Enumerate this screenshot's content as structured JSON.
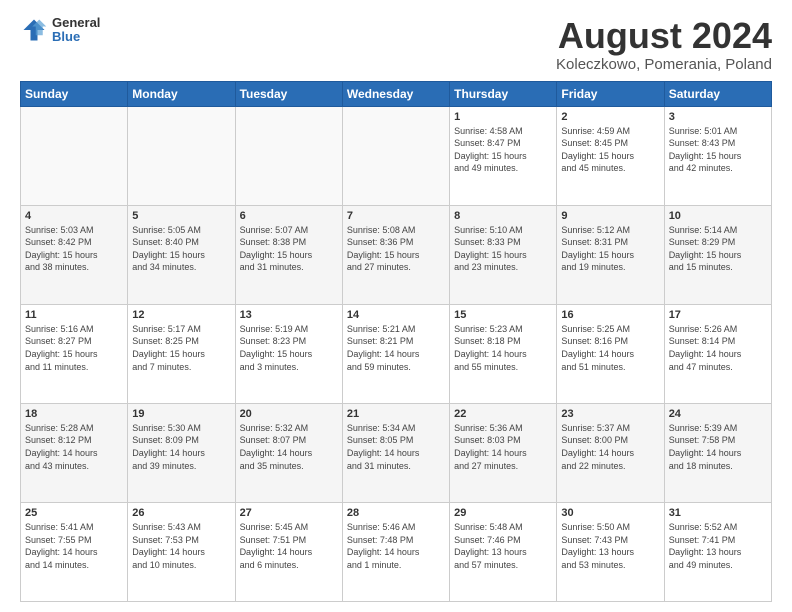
{
  "header": {
    "logo_line1": "General",
    "logo_line2": "Blue",
    "main_title": "August 2024",
    "subtitle": "Koleczkowo, Pomerania, Poland"
  },
  "weekdays": [
    "Sunday",
    "Monday",
    "Tuesday",
    "Wednesday",
    "Thursday",
    "Friday",
    "Saturday"
  ],
  "weeks": [
    [
      {
        "day": "",
        "info": ""
      },
      {
        "day": "",
        "info": ""
      },
      {
        "day": "",
        "info": ""
      },
      {
        "day": "",
        "info": ""
      },
      {
        "day": "1",
        "info": "Sunrise: 4:58 AM\nSunset: 8:47 PM\nDaylight: 15 hours\nand 49 minutes."
      },
      {
        "day": "2",
        "info": "Sunrise: 4:59 AM\nSunset: 8:45 PM\nDaylight: 15 hours\nand 45 minutes."
      },
      {
        "day": "3",
        "info": "Sunrise: 5:01 AM\nSunset: 8:43 PM\nDaylight: 15 hours\nand 42 minutes."
      }
    ],
    [
      {
        "day": "4",
        "info": "Sunrise: 5:03 AM\nSunset: 8:42 PM\nDaylight: 15 hours\nand 38 minutes."
      },
      {
        "day": "5",
        "info": "Sunrise: 5:05 AM\nSunset: 8:40 PM\nDaylight: 15 hours\nand 34 minutes."
      },
      {
        "day": "6",
        "info": "Sunrise: 5:07 AM\nSunset: 8:38 PM\nDaylight: 15 hours\nand 31 minutes."
      },
      {
        "day": "7",
        "info": "Sunrise: 5:08 AM\nSunset: 8:36 PM\nDaylight: 15 hours\nand 27 minutes."
      },
      {
        "day": "8",
        "info": "Sunrise: 5:10 AM\nSunset: 8:33 PM\nDaylight: 15 hours\nand 23 minutes."
      },
      {
        "day": "9",
        "info": "Sunrise: 5:12 AM\nSunset: 8:31 PM\nDaylight: 15 hours\nand 19 minutes."
      },
      {
        "day": "10",
        "info": "Sunrise: 5:14 AM\nSunset: 8:29 PM\nDaylight: 15 hours\nand 15 minutes."
      }
    ],
    [
      {
        "day": "11",
        "info": "Sunrise: 5:16 AM\nSunset: 8:27 PM\nDaylight: 15 hours\nand 11 minutes."
      },
      {
        "day": "12",
        "info": "Sunrise: 5:17 AM\nSunset: 8:25 PM\nDaylight: 15 hours\nand 7 minutes."
      },
      {
        "day": "13",
        "info": "Sunrise: 5:19 AM\nSunset: 8:23 PM\nDaylight: 15 hours\nand 3 minutes."
      },
      {
        "day": "14",
        "info": "Sunrise: 5:21 AM\nSunset: 8:21 PM\nDaylight: 14 hours\nand 59 minutes."
      },
      {
        "day": "15",
        "info": "Sunrise: 5:23 AM\nSunset: 8:18 PM\nDaylight: 14 hours\nand 55 minutes."
      },
      {
        "day": "16",
        "info": "Sunrise: 5:25 AM\nSunset: 8:16 PM\nDaylight: 14 hours\nand 51 minutes."
      },
      {
        "day": "17",
        "info": "Sunrise: 5:26 AM\nSunset: 8:14 PM\nDaylight: 14 hours\nand 47 minutes."
      }
    ],
    [
      {
        "day": "18",
        "info": "Sunrise: 5:28 AM\nSunset: 8:12 PM\nDaylight: 14 hours\nand 43 minutes."
      },
      {
        "day": "19",
        "info": "Sunrise: 5:30 AM\nSunset: 8:09 PM\nDaylight: 14 hours\nand 39 minutes."
      },
      {
        "day": "20",
        "info": "Sunrise: 5:32 AM\nSunset: 8:07 PM\nDaylight: 14 hours\nand 35 minutes."
      },
      {
        "day": "21",
        "info": "Sunrise: 5:34 AM\nSunset: 8:05 PM\nDaylight: 14 hours\nand 31 minutes."
      },
      {
        "day": "22",
        "info": "Sunrise: 5:36 AM\nSunset: 8:03 PM\nDaylight: 14 hours\nand 27 minutes."
      },
      {
        "day": "23",
        "info": "Sunrise: 5:37 AM\nSunset: 8:00 PM\nDaylight: 14 hours\nand 22 minutes."
      },
      {
        "day": "24",
        "info": "Sunrise: 5:39 AM\nSunset: 7:58 PM\nDaylight: 14 hours\nand 18 minutes."
      }
    ],
    [
      {
        "day": "25",
        "info": "Sunrise: 5:41 AM\nSunset: 7:55 PM\nDaylight: 14 hours\nand 14 minutes."
      },
      {
        "day": "26",
        "info": "Sunrise: 5:43 AM\nSunset: 7:53 PM\nDaylight: 14 hours\nand 10 minutes."
      },
      {
        "day": "27",
        "info": "Sunrise: 5:45 AM\nSunset: 7:51 PM\nDaylight: 14 hours\nand 6 minutes."
      },
      {
        "day": "28",
        "info": "Sunrise: 5:46 AM\nSunset: 7:48 PM\nDaylight: 14 hours\nand 1 minute."
      },
      {
        "day": "29",
        "info": "Sunrise: 5:48 AM\nSunset: 7:46 PM\nDaylight: 13 hours\nand 57 minutes."
      },
      {
        "day": "30",
        "info": "Sunrise: 5:50 AM\nSunset: 7:43 PM\nDaylight: 13 hours\nand 53 minutes."
      },
      {
        "day": "31",
        "info": "Sunrise: 5:52 AM\nSunset: 7:41 PM\nDaylight: 13 hours\nand 49 minutes."
      }
    ]
  ]
}
